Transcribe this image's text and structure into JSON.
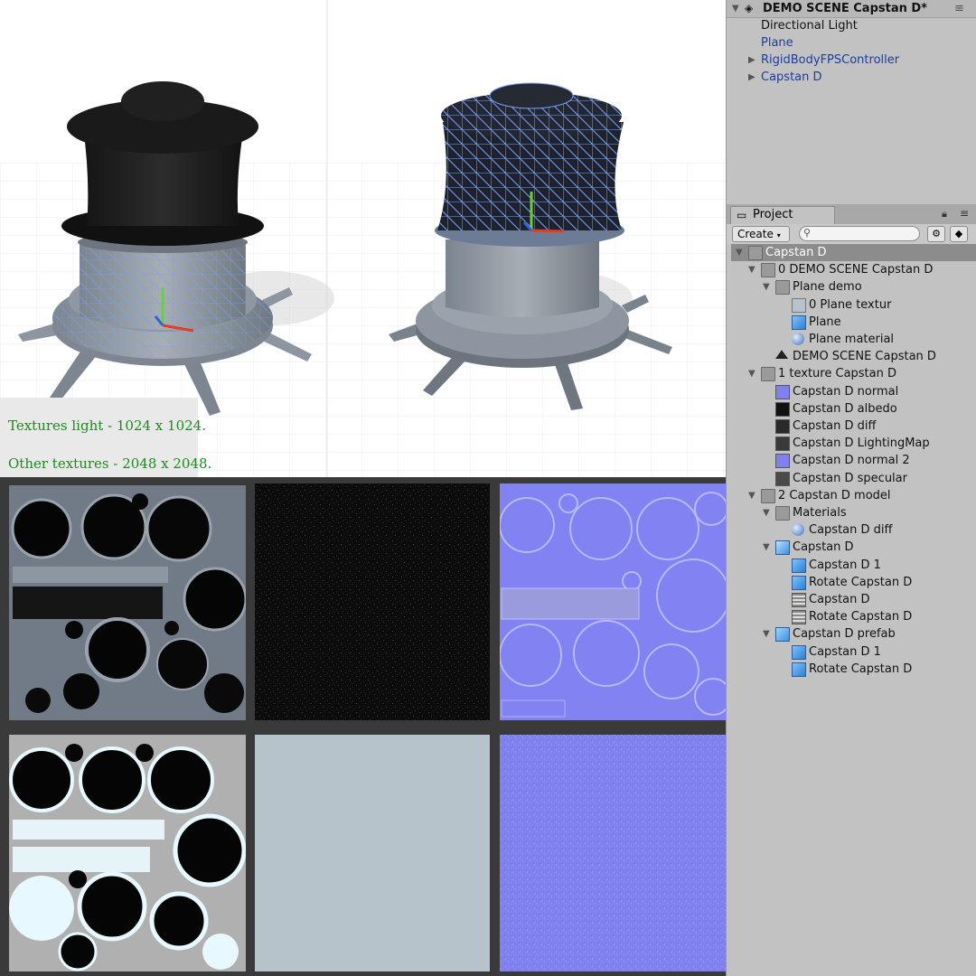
{
  "viewport": {
    "note_light": "Textures light - 1024  x 1024.",
    "note_other": "Other textures - 2048 x 2048."
  },
  "hierarchy": {
    "scene_name": "DEMO SCENE Capstan D*",
    "items": [
      {
        "label": "Directional Light",
        "color": "#111111"
      },
      {
        "label": "Plane",
        "color": "#1a3d9e"
      },
      {
        "label": "RigidBodyFPSController",
        "color": "#1a3d9e"
      },
      {
        "label": "Capstan D",
        "color": "#1a3d9e"
      }
    ]
  },
  "project": {
    "tab_label": "Project",
    "create_label": "Create",
    "tree": [
      {
        "label": "Capstan D",
        "icon": "folder-icon"
      },
      {
        "label": "0 DEMO SCENE Capstan D",
        "icon": "folder-icon"
      },
      {
        "label": "Plane demo",
        "icon": "folder-icon"
      },
      {
        "label": "0 Plane textur",
        "icon": "texture-icon"
      },
      {
        "label": "Plane",
        "icon": "mesh-icon"
      },
      {
        "label": "Plane material",
        "icon": "material-icon"
      },
      {
        "label": "DEMO SCENE Capstan D",
        "icon": "unity-scene-icon"
      },
      {
        "label": "1 texture Capstan D",
        "icon": "folder-icon"
      },
      {
        "label": "Capstan D  normal",
        "icon": "texture-icon"
      },
      {
        "label": "Capstan D albedo",
        "icon": "texture-icon"
      },
      {
        "label": "Capstan D diff",
        "icon": "texture-icon"
      },
      {
        "label": "Capstan D LightingMap",
        "icon": "texture-icon"
      },
      {
        "label": "Capstan D normal 2",
        "icon": "texture-icon"
      },
      {
        "label": "Capstan D specular",
        "icon": "texture-icon"
      },
      {
        "label": "2 Capstan D model",
        "icon": "folder-icon"
      },
      {
        "label": "Materials",
        "icon": "folder-icon"
      },
      {
        "label": "Capstan D diff",
        "icon": "material-icon"
      },
      {
        "label": "Capstan D",
        "icon": "model-icon"
      },
      {
        "label": "Capstan D 1",
        "icon": "mesh-icon"
      },
      {
        "label": "Rotate Capstan D",
        "icon": "mesh-icon"
      },
      {
        "label": "Capstan D",
        "icon": "avatar-icon"
      },
      {
        "label": "Rotate Capstan D",
        "icon": "avatar-icon"
      },
      {
        "label": "Capstan D prefab",
        "icon": "prefab-icon"
      },
      {
        "label": "Capstan D 1",
        "icon": "mesh-icon"
      },
      {
        "label": "Rotate Capstan D",
        "icon": "mesh-icon"
      }
    ]
  },
  "colors": {
    "note_green": "#1f8a1f",
    "normal_blue": "#8484f4",
    "selection": "#8c8c8c"
  }
}
